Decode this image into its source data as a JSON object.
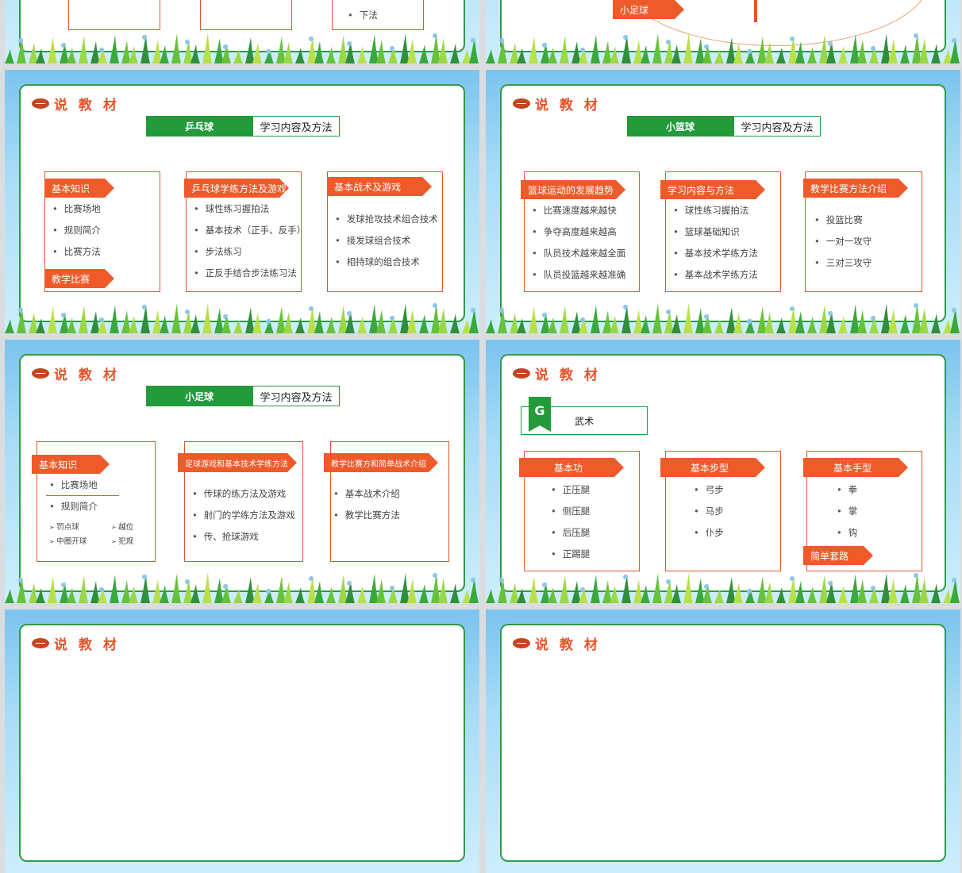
{
  "slides": {
    "s1": {
      "item": "下法"
    },
    "s2": {
      "tag": "小足球"
    },
    "header_title": "说 教 材",
    "s3": {
      "sport": "乒乓球",
      "subtitle": "学习内容及方法",
      "col1": {
        "tag": "基本知识",
        "items": [
          "比赛场地",
          "规则简介",
          "比赛方法"
        ],
        "tag2": "教学比赛"
      },
      "col2": {
        "tag": "乒乓球学练方法及游戏",
        "items": [
          "球性练习握拍法",
          "基本技术（正手、反手）",
          "步法练习",
          "正反手结合步法练习法"
        ]
      },
      "col3": {
        "tag": "基本战术及游戏",
        "items": [
          "发球抢攻技术组合技术",
          "接发球组合技术",
          "相持球的组合技术"
        ]
      }
    },
    "s4": {
      "sport": "小篮球",
      "subtitle": "学习内容及方法",
      "col1": {
        "tag": "篮球运动的发展趋势",
        "items": [
          "比赛速度越来越快",
          "争夺高度越来越高",
          "队员技术越来越全面",
          "队员投篮越来越准确"
        ]
      },
      "col2": {
        "tag": "学习内容与方法",
        "items": [
          "球性练习握拍法",
          "篮球基础知识",
          "基本技术学练方法",
          "基本战术学练方法"
        ]
      },
      "col3": {
        "tag": "教学比赛方法介绍",
        "items": [
          "投篮比赛",
          "一对一攻守",
          "三对三攻守"
        ]
      }
    },
    "s5": {
      "sport": "小足球",
      "subtitle": "学习内容及方法",
      "col1": {
        "tag": "基本知识",
        "items": [
          "比赛场地",
          "规则简介"
        ],
        "sub": [
          "罚点球",
          "越位",
          "中圈开球",
          "犯规"
        ]
      },
      "col2": {
        "tag": "足球游戏和基本技术学练方法",
        "items": [
          "传球的练方法及游戏",
          "射门的学练方法及游戏",
          "传、抢球游戏"
        ]
      },
      "col3": {
        "tag": "教学比赛方和简单战术介绍",
        "items": [
          "基本战术介绍",
          "教学比赛方法"
        ]
      }
    },
    "s6": {
      "icon_letter": "G",
      "sport": "武术",
      "col1": {
        "tag": "基本功",
        "items": [
          "正压腿",
          "侧压腿",
          "后压腿",
          "正踢腿"
        ]
      },
      "col2": {
        "tag": "基本步型",
        "items": [
          "弓步",
          "马步",
          "仆步"
        ]
      },
      "col3": {
        "tag": "基本手型",
        "items": [
          "拳",
          "掌",
          "钩"
        ],
        "tag2": "简单套路"
      }
    }
  },
  "colors": {
    "accent_orange": "#ee5a2a",
    "accent_green": "#239a3b"
  }
}
